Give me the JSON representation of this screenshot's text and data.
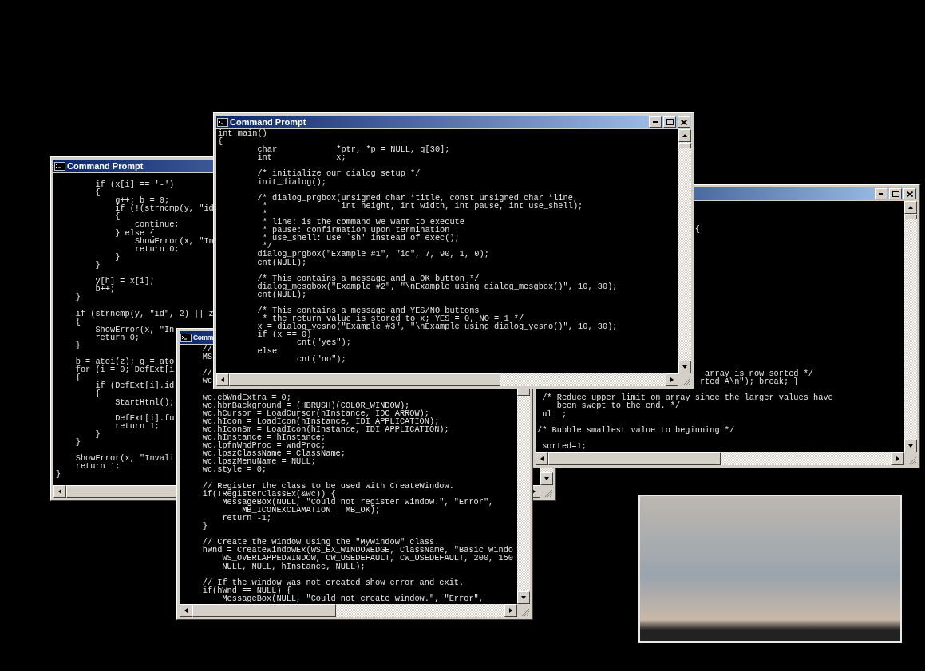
{
  "windows": [
    {
      "title": "Command Prompt",
      "code_blocks": [
        [
          "        if (x[i] == '-')",
          "        {",
          "            g++; b = 0;",
          "            if (!(strncmp(y, \"id",
          "            {",
          "                continue;",
          "            } else {",
          "                ShowError(x, \"In",
          "                return 0;",
          "            }",
          "        }"
        ],
        [
          "        y[h] = x[i];",
          "        b++;",
          "    }"
        ],
        [
          "    if (strncmp(y, \"id\", 2) || z",
          "    {",
          "        ShowError(x, \"In",
          "        return 0;",
          "    }"
        ],
        [
          "    b = atoi(z); g = ato",
          "    for (i = 0; DefExt[i",
          "    {",
          "        if (DefExt[i].id",
          "        {",
          "            StartHtml();"
        ],
        [
          "            DefExt[i].fu",
          "            return 1;",
          "        }",
          "    }"
        ],
        [
          "    ShowError(x, \"Invali",
          "    return 1;",
          "}"
        ]
      ]
    },
    {
      "code_blocks": [
        [
          "                                {"
        ],
        [
          "                                  array is now sorted */",
          "                                 rted A\\n\"); break; }"
        ],
        [
          " /* Reduce upper limit on array since the larger values have",
          "    been swept to the end. */",
          " ul  ;"
        ],
        [
          "/* Bubble smallest value to beginning */"
        ],
        [
          " sorted=1;"
        ]
      ]
    },
    {
      "title": "Comm",
      "code_blocks": [
        [
          "    //",
          "    MS"
        ],
        [
          "    //",
          "    wc"
        ],
        [
          "    wc.cbWndExtra = 0;",
          "    wc.hbrBackground = (HBRUSH)(COLOR_WINDOW);",
          "    wc.hCursor = LoadCursor(hInstance, IDC_ARROW);",
          "    wc.hIcon = LoadIcon(hInstance, IDI_APPLICATION);",
          "    wc.hIconSm = LoadIcon(hInstance, IDI_APPLICATION);",
          "    wc.hInstance = hInstance;",
          "    wc.lpfnWndProc = WndProc;",
          "    wc.lpszClassName = ClassName;",
          "    wc.lpszMenuName = NULL;",
          "    wc.style = 0;"
        ],
        [
          "    // Register the class to be used with CreateWindow.",
          "    if(!RegisterClassEx(&wc)) {",
          "        MessageBox(NULL, \"Could not register window.\", \"Error\",",
          "            MB_ICONEXCLAMATION | MB_OK);",
          "        return -1;",
          "    }"
        ],
        [
          "    // Create the window using the \"MyWindow\" class.",
          "    hWnd = CreateWindowEx(WS_EX_WINDOWEDGE, ClassName, \"Basic Windo",
          "        WS_OVERLAPPEDWINDOW, CW_USEDEFAULT, CW_USEDEFAULT, 200, 150",
          "        NULL, NULL, hInstance, NULL);"
        ],
        [
          "    // If the window was not created show error and exit.",
          "    if(hWnd == NULL) {",
          "        MessageBox(NULL, \"Could not create window.\", \"Error\","
        ]
      ]
    },
    {
      "title": "Command Prompt",
      "code_blocks": [
        [
          "int main()",
          "{",
          "        char            *ptr, *p = NULL, q[30];",
          "        int             x;"
        ],
        [
          "        /* initialize our dialog setup */",
          "        init_dialog();"
        ],
        [
          "        /* dialog_prgbox(unsigned char *title, const unsigned char *line,",
          "         *               int height, int width, int pause, int use_shell);",
          "         *",
          "         * line: is the command we want to execute",
          "         * pause: confirmation upon termination",
          "         * use_shell: use `sh' instead of exec();",
          "         */",
          "        dialog_prgbox(\"Example #1\", \"id\", 7, 90, 1, 0);",
          "        cnt(NULL);"
        ],
        [
          "        /* This contains a message and a OK button */",
          "        dialog_mesgbox(\"Example #2\", \"\\nExample using dialog_mesgbox()\", 10, 30);",
          "        cnt(NULL);"
        ],
        [
          "        /* This contains a message and YES/NO buttons",
          "         * the return value is stored to x; YES = 0, NO = 1 */",
          "        x = dialog_yesno(\"Example #3\", \"\\nExample using dialog_yesno()\", 10, 30);",
          "        if (x == 0)",
          "                cnt(\"yes\");",
          "        else",
          "                cnt(\"no\");"
        ]
      ]
    }
  ]
}
